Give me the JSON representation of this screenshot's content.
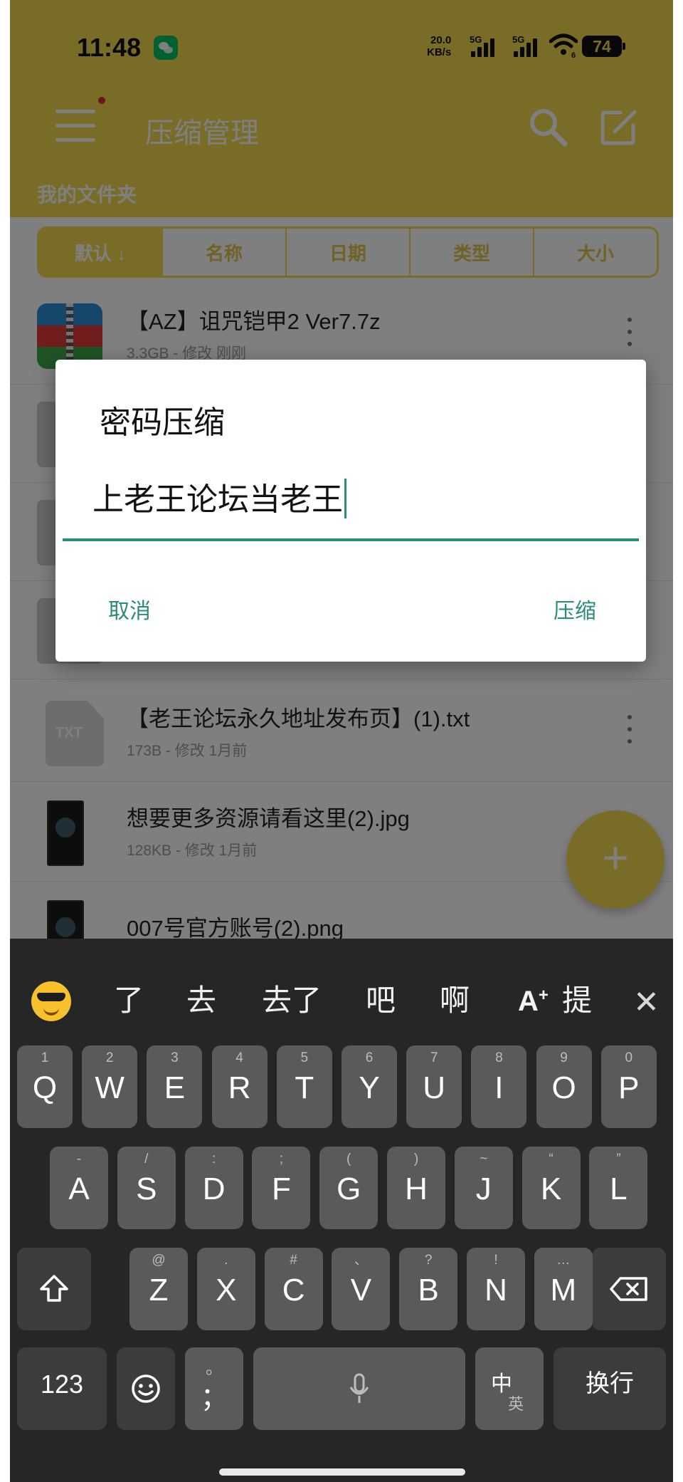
{
  "status_bar": {
    "time": "11:48",
    "net_speed_value": "20.0",
    "net_speed_unit": "KB/s",
    "network_label_1": "5G",
    "network_label_2": "5G",
    "wifi_label": "6",
    "battery": "74"
  },
  "app_bar": {
    "title": "压缩管理",
    "folder_title": "我的文件夹"
  },
  "sort_tabs": [
    "默认 ↓",
    "名称",
    "日期",
    "类型",
    "大小"
  ],
  "files": [
    {
      "name": "【AZ】诅咒铠甲2 Ver7.7z",
      "meta": "3.3GB - 修改 刚刚",
      "icon": "zip-icon"
    },
    {
      "name": "",
      "meta": "",
      "icon": "file-icon"
    },
    {
      "name": "",
      "meta": "",
      "icon": "file-icon"
    },
    {
      "name": "",
      "meta": "",
      "icon": "file-icon"
    },
    {
      "name": "【老王论坛永久地址发布页】(1).txt",
      "meta": "173B - 修改 1月前",
      "icon": "txt-icon"
    },
    {
      "name": "想要更多资源请看这里(2).jpg",
      "meta": "128KB - 修改 1月前",
      "icon": "image-icon"
    },
    {
      "name": "007号官方账号(2).png",
      "meta": "",
      "icon": "image-icon"
    }
  ],
  "txt_badge": "TXT",
  "fab_label": "+",
  "dialog": {
    "title": "密码压缩",
    "input_value": "上老王论坛当老王",
    "cancel_label": "取消",
    "confirm_label": "压缩"
  },
  "keyboard": {
    "suggestions": [
      "了",
      "去",
      "去了",
      "吧",
      "啊"
    ],
    "ai_suggestion": "提",
    "rows": [
      [
        [
          "Q",
          "1"
        ],
        [
          "W",
          "2"
        ],
        [
          "E",
          "3"
        ],
        [
          "R",
          "4"
        ],
        [
          "T",
          "5"
        ],
        [
          "Y",
          "6"
        ],
        [
          "U",
          "7"
        ],
        [
          "I",
          "8"
        ],
        [
          "O",
          "9"
        ],
        [
          "P",
          "0"
        ]
      ],
      [
        [
          "A",
          "-"
        ],
        [
          "S",
          "/"
        ],
        [
          "D",
          ":"
        ],
        [
          "F",
          ";"
        ],
        [
          "G",
          "("
        ],
        [
          "H",
          ")"
        ],
        [
          "J",
          "~"
        ],
        [
          "K",
          "“"
        ],
        [
          "L",
          "”"
        ]
      ],
      [
        [
          "Z",
          "@"
        ],
        [
          "X",
          "."
        ],
        [
          "C",
          "#"
        ],
        [
          "V",
          "、"
        ],
        [
          "B",
          "?"
        ],
        [
          "N",
          "!"
        ],
        [
          "M",
          "…"
        ]
      ]
    ],
    "num_label": "123",
    "punct_key": "；",
    "punct_key_sub": "。",
    "lang_key_main": "中",
    "lang_key_sub": "英",
    "enter_label": "换行"
  },
  "colors": {
    "app_bar": "#f2d84f",
    "accent": "#2a8d7a",
    "keyboard_bg": "#262626",
    "key_bg": "#5a5a5a"
  }
}
